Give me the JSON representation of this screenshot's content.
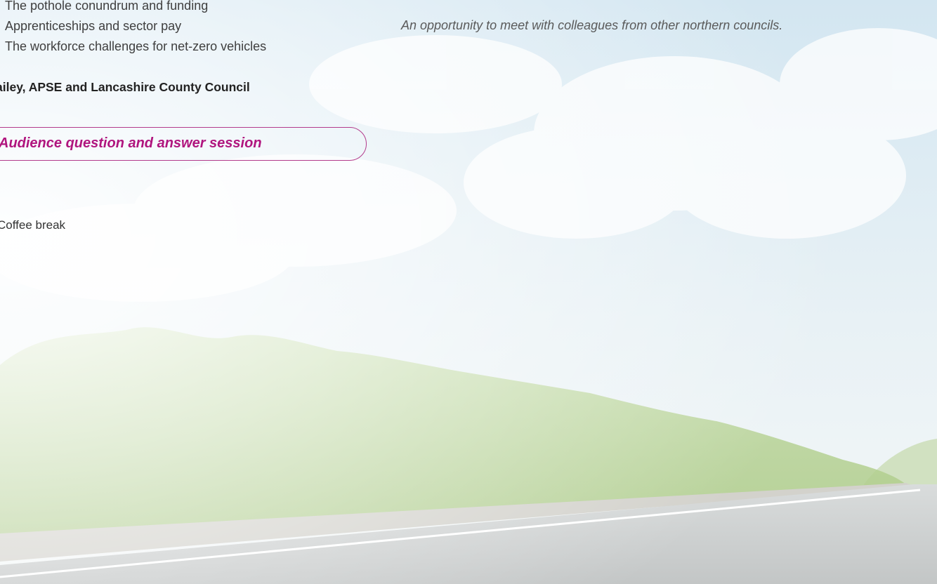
{
  "agenda": {
    "topics": [
      "The pothole conundrum and funding",
      "Apprenticeships and sector pay",
      "The workforce challenges for net-zero vehicles"
    ],
    "speakers": "ailey, APSE and Lancashire County Council",
    "qa_session": "Audience question and answer session",
    "break_label": "Coffee break"
  },
  "aside": {
    "note": "An opportunity to meet with colleagues from other northern councils."
  },
  "colors": {
    "accent": "#b0157e",
    "pill_border": "#b33b8c",
    "body_text": "#3f3f3f"
  }
}
